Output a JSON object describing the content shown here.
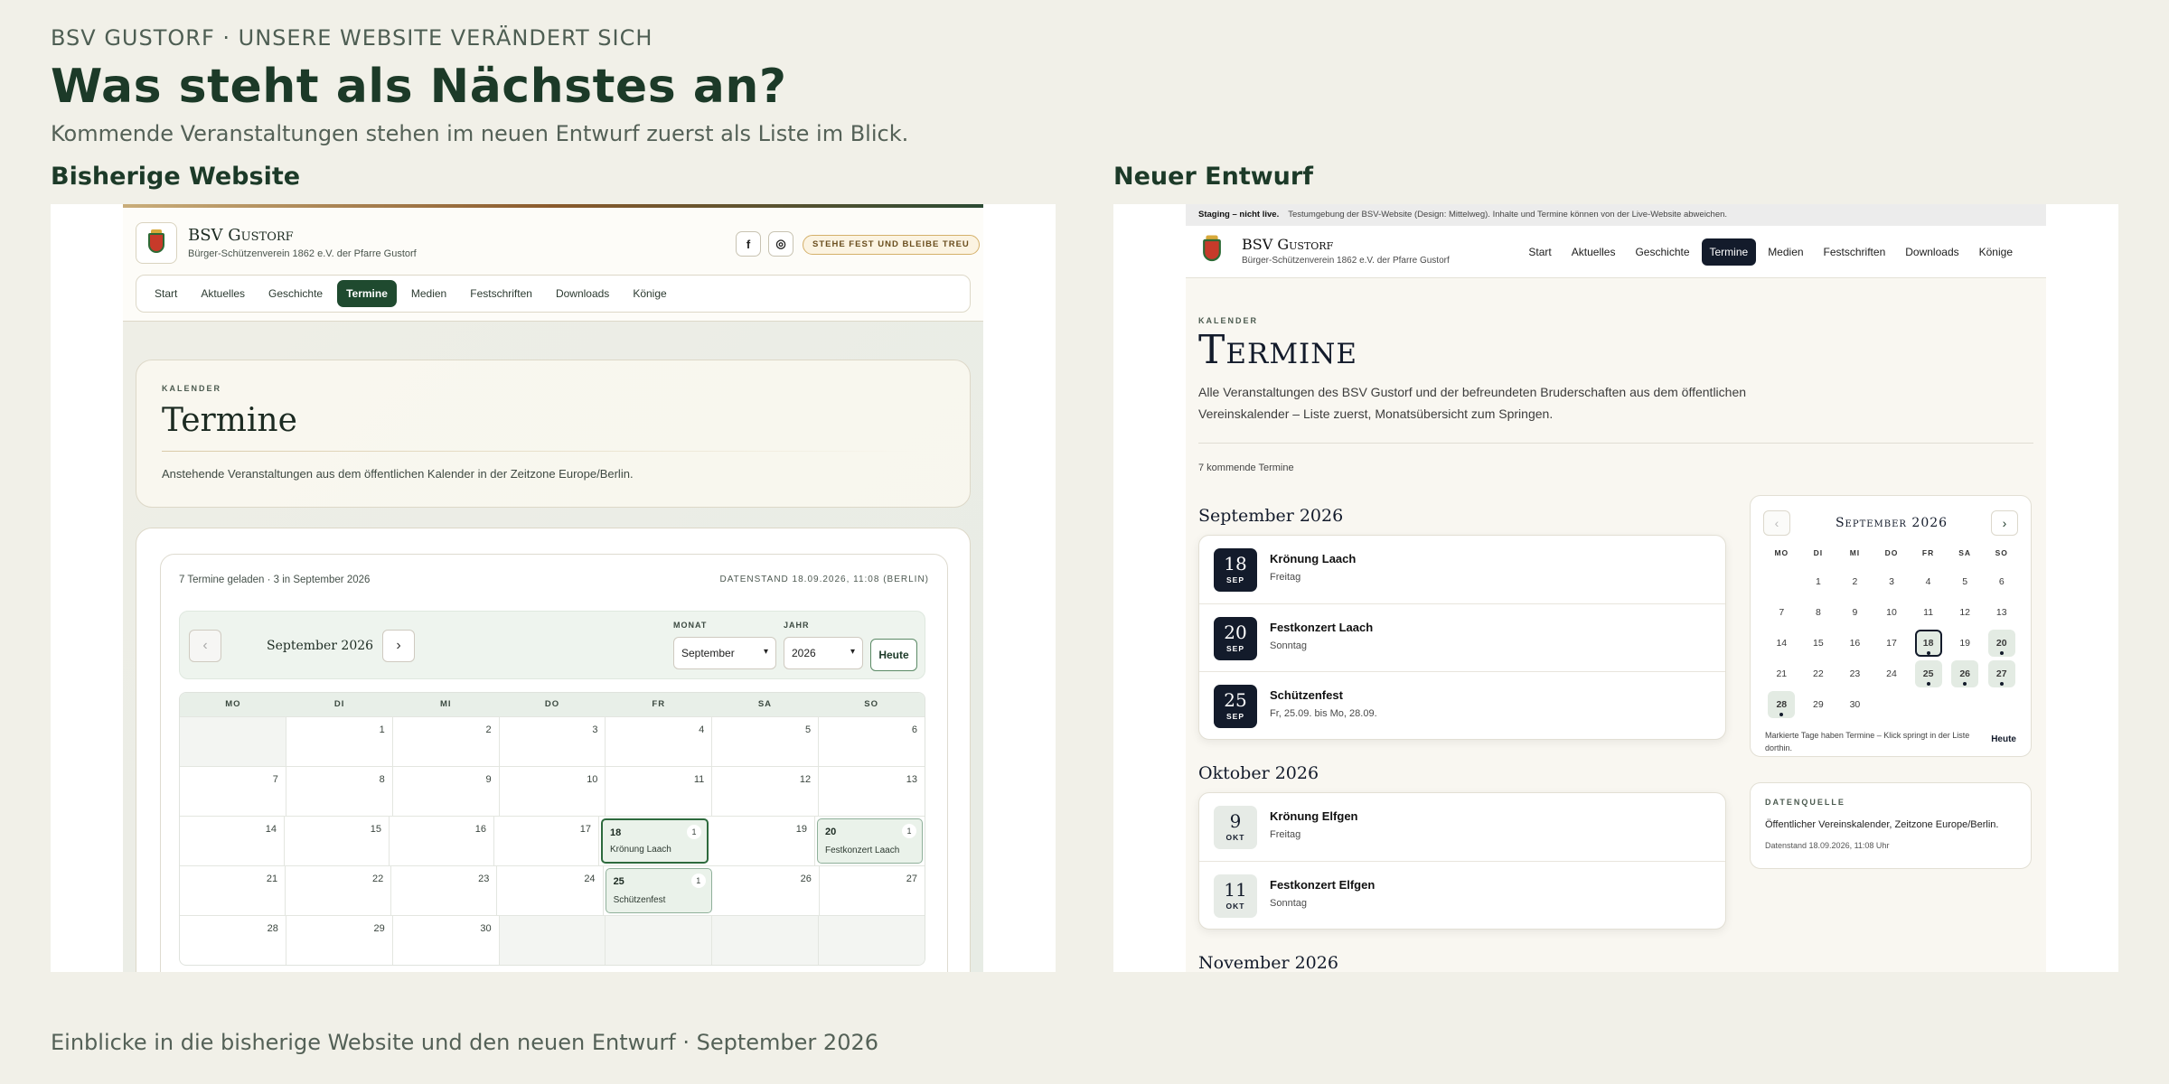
{
  "header": {
    "kicker": "BSV GUSTORF · UNSERE WEBSITE VERÄNDERT SICH",
    "title": "Was steht als Nächstes an?",
    "subtitle": "Kommende Veranstaltungen stehen im neuen Entwurf zuerst als Liste im Blick.",
    "label_old": "Bisherige Website",
    "label_new": "Neuer Entwurf",
    "footer": "Einblicke in die bisherige Website und den neuen Entwurf · September 2026"
  },
  "old": {
    "brand": "BSV Gustorf",
    "tagline": "Bürger-Schützenverein 1862 e.V. der Pfarre Gustorf",
    "icon_facebook": "f",
    "icon_instagram": "◎",
    "motto": "STEHE FEST UND BLEIBE TREU",
    "nav": [
      "Start",
      "Aktuelles",
      "Geschichte",
      "Termine",
      "Medien",
      "Festschriften",
      "Downloads",
      "Könige"
    ],
    "eyebrow": "KALENDER",
    "title": "Termine",
    "description": "Anstehende Veranstaltungen aus dem öffentlichen Kalender in der Zeitzone Europe/Berlin.",
    "loaded": "7 Termine geladen · 3 in September 2026",
    "datastand": "DATENSTAND 18.09.2026, 11:08 (BERLIN)",
    "prev": "‹",
    "next": "›",
    "month_label": "September 2026",
    "month_field": "MONAT",
    "month_value": "September",
    "year_field": "JAHR",
    "year_value": "2026",
    "today": "Heute",
    "weekdays": [
      "MO",
      "DI",
      "MI",
      "DO",
      "FR",
      "SA",
      "SO"
    ],
    "weeks": [
      [
        {
          "d": ""
        },
        {
          "d": "1"
        },
        {
          "d": "2"
        },
        {
          "d": "3"
        },
        {
          "d": "4"
        },
        {
          "d": "5"
        },
        {
          "d": "6"
        }
      ],
      [
        {
          "d": "7"
        },
        {
          "d": "8"
        },
        {
          "d": "9"
        },
        {
          "d": "10"
        },
        {
          "d": "11"
        },
        {
          "d": "12"
        },
        {
          "d": "13"
        }
      ],
      [
        {
          "d": "14"
        },
        {
          "d": "15"
        },
        {
          "d": "16"
        },
        {
          "d": "17"
        },
        {
          "d": "18",
          "c": "1",
          "e": "Krönung Laach",
          "sel": true
        },
        {
          "d": "19"
        },
        {
          "d": "20",
          "c": "1",
          "e": "Festkonzert Laach"
        }
      ],
      [
        {
          "d": "21"
        },
        {
          "d": "22"
        },
        {
          "d": "23"
        },
        {
          "d": "24"
        },
        {
          "d": "25",
          "c": "1",
          "e": "Schützenfest"
        },
        {
          "d": "26"
        },
        {
          "d": "27"
        }
      ],
      [
        {
          "d": "28"
        },
        {
          "d": "29"
        },
        {
          "d": "30"
        },
        {
          "d": ""
        },
        {
          "d": ""
        },
        {
          "d": ""
        },
        {
          "d": ""
        }
      ]
    ]
  },
  "new": {
    "staging_bold": "Staging – nicht live.",
    "staging_text": "Testumgebung der BSV-Website (Design: Mittelweg). Inhalte und Termine können von der Live-Website abweichen.",
    "brand": "BSV Gustorf",
    "tagline": "Bürger-Schützenverein 1862 e.V. der Pfarre Gustorf",
    "nav": [
      "Start",
      "Aktuelles",
      "Geschichte",
      "Termine",
      "Medien",
      "Festschriften",
      "Downloads",
      "Könige"
    ],
    "eyebrow": "KALENDER",
    "title": "Termine",
    "description": "Alle Veranstaltungen des BSV Gustorf und der befreundeten Bruderschaften aus dem öffentlichen Vereinskalender – Liste zuerst, Monatsübersicht zum Springen.",
    "count": "7 kommende Termine",
    "months": [
      {
        "name": "September 2026",
        "events": [
          {
            "day": "18",
            "mon": "SEP",
            "title": "Krönung Laach",
            "sub": "Freitag",
            "dark": true
          },
          {
            "day": "20",
            "mon": "SEP",
            "title": "Festkonzert Laach",
            "sub": "Sonntag",
            "dark": true
          },
          {
            "day": "25",
            "mon": "SEP",
            "title": "Schützenfest",
            "sub": "Fr, 25.09. bis Mo, 28.09.",
            "dark": true
          }
        ]
      },
      {
        "name": "Oktober 2026",
        "events": [
          {
            "day": "9",
            "mon": "OKT",
            "title": "Krönung Elfgen",
            "sub": "Freitag",
            "dark": false
          },
          {
            "day": "11",
            "mon": "OKT",
            "title": "Festkonzert Elfgen",
            "sub": "Sonntag",
            "dark": false
          }
        ]
      },
      {
        "name": "November 2026",
        "events": []
      }
    ],
    "minical": {
      "title": "September 2026",
      "prev": "‹",
      "next": "›",
      "weekdays": [
        "MO",
        "DI",
        "MI",
        "DO",
        "FR",
        "SA",
        "SO"
      ],
      "weeks": [
        [
          {
            "d": ""
          },
          {
            "d": "1"
          },
          {
            "d": "2"
          },
          {
            "d": "3"
          },
          {
            "d": "4"
          },
          {
            "d": "5"
          },
          {
            "d": "6"
          }
        ],
        [
          {
            "d": "7"
          },
          {
            "d": "8"
          },
          {
            "d": "9"
          },
          {
            "d": "10"
          },
          {
            "d": "11"
          },
          {
            "d": "12"
          },
          {
            "d": "13"
          }
        ],
        [
          {
            "d": "14"
          },
          {
            "d": "15"
          },
          {
            "d": "16"
          },
          {
            "d": "17"
          },
          {
            "d": "18",
            "ev": true,
            "sel": true
          },
          {
            "d": "19"
          },
          {
            "d": "20",
            "ev": true
          }
        ],
        [
          {
            "d": "21"
          },
          {
            "d": "22"
          },
          {
            "d": "23"
          },
          {
            "d": "24"
          },
          {
            "d": "25",
            "ev": true
          },
          {
            "d": "26",
            "ev": true
          },
          {
            "d": "27",
            "ev": true
          }
        ],
        [
          {
            "d": "28",
            "ev": true
          },
          {
            "d": "29"
          },
          {
            "d": "30"
          },
          {
            "d": ""
          },
          {
            "d": ""
          },
          {
            "d": ""
          },
          {
            "d": ""
          }
        ]
      ],
      "hint": "Markierte Tage haben Termine – Klick springt in der Liste dorthin.",
      "today": "Heute"
    },
    "source": {
      "eyebrow": "DATENQUELLE",
      "text": "Öffentlicher Vereinskalender, Zeitzone Europe/Berlin.",
      "stand": "Datenstand 18.09.2026, 11:08 Uhr"
    }
  }
}
